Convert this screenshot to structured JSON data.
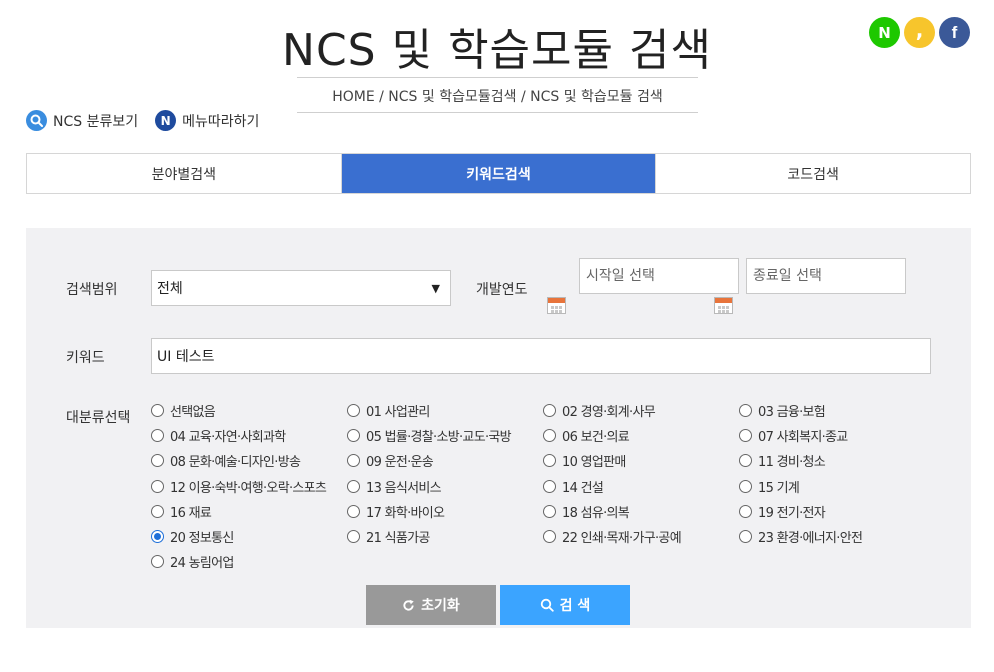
{
  "header": {
    "title": "NCS 및 학습모듈 검색",
    "breadcrumb": "HOME / NCS 및 학습모듈검색 / NCS 및 학습모듈 검색"
  },
  "social": {
    "naver_letter": "N",
    "kakao_letter": ",",
    "facebook_letter": "f",
    "colors": {
      "naver": "#1ec800",
      "kakao": "#f7c52c",
      "facebook": "#3b5998"
    }
  },
  "quicklinks": {
    "classification": "NCS 분류보기",
    "menu_follow": "메뉴따라하기",
    "menu_icon_letter": "N"
  },
  "tabs": [
    {
      "label": "분야별검색",
      "active": false
    },
    {
      "label": "키워드검색",
      "active": true
    },
    {
      "label": "코드검색",
      "active": false
    }
  ],
  "form": {
    "scope_label": "검색범위",
    "scope_value": "전체",
    "year_label": "개발연도",
    "start_placeholder": "시작일 선택",
    "end_placeholder": "종료일 선택",
    "keyword_label": "키워드",
    "keyword_value": "UI 테스트",
    "category_label": "대분류선택",
    "categories": [
      "선택없음",
      "01 사업관리",
      "02 경영·회계·사무",
      "03 금융·보험",
      "04 교육·자연·사회과학",
      "05 법률·경찰·소방·교도·국방",
      "06 보건·의료",
      "07 사회복지·종교",
      "08 문화·예술·디자인·방송",
      "09 운전·운송",
      "10 영업판매",
      "11 경비·청소",
      "12 이용·숙박·여행·오락·스포츠",
      "13 음식서비스",
      "14 건설",
      "15 기계",
      "16 재료",
      "17 화학·바이오",
      "18 섬유·의복",
      "19 전기·전자",
      "20 정보통신",
      "21 식품가공",
      "22 인쇄·목재·가구·공예",
      "23 환경·에너지·안전",
      "24 농림어업"
    ],
    "selected_category": "20 정보통신"
  },
  "buttons": {
    "reset": "초기화",
    "search": "검 색"
  },
  "colors": {
    "accent": "#3a6fd0",
    "search_button": "#3ba4ff",
    "reset_button": "#999999",
    "panel_bg": "#f1f1f3"
  }
}
